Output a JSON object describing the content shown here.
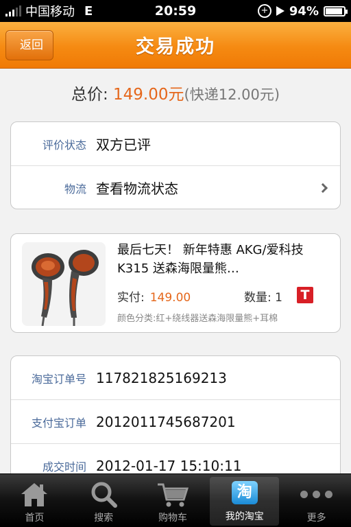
{
  "status_bar": {
    "carrier": "中国移动",
    "network": "E",
    "time": "20:59",
    "battery": "94%",
    "battery_level": 0.94
  },
  "nav": {
    "back_label": "返回",
    "title": "交易成功"
  },
  "summary": {
    "total_label": "总价: ",
    "total_value": "149.00元",
    "shipping": "(快递12.00元)"
  },
  "status_card": {
    "rows": [
      {
        "label": "评价状态",
        "value": "双方已评"
      },
      {
        "label": "物流",
        "value": "查看物流状态"
      }
    ]
  },
  "product": {
    "title": "最后七天！ 新年特惠 AKG/爱科技 K315  送森海限量熊…",
    "paid_label": "实付:",
    "paid_value": "149.00",
    "qty_label": "数量: 1",
    "badge": "T",
    "spec": "颜色分类:红+绕线器送森海限量熊+耳棉"
  },
  "order_card": {
    "rows": [
      {
        "label": "淘宝订单号",
        "value": "117821825169213"
      },
      {
        "label": "支付宝订单",
        "value": "2012011745687201"
      },
      {
        "label": "成交时间",
        "value": "2012-01-17 15:10:11"
      }
    ]
  },
  "tab_bar": {
    "tabs": [
      {
        "label": "首页",
        "icon": "home-icon"
      },
      {
        "label": "搜索",
        "icon": "search-icon"
      },
      {
        "label": "购物车",
        "icon": "cart-icon"
      },
      {
        "label": "我的淘宝",
        "icon": "taobao-icon",
        "icon_text": "淘"
      },
      {
        "label": "更多",
        "icon": "more-icon"
      }
    ],
    "active_index": 3
  },
  "colors": {
    "accent_orange": "#f58a12",
    "price_orange": "#e5671b",
    "label_blue": "#4a6a9a",
    "tmall_red": "#d81f26"
  }
}
